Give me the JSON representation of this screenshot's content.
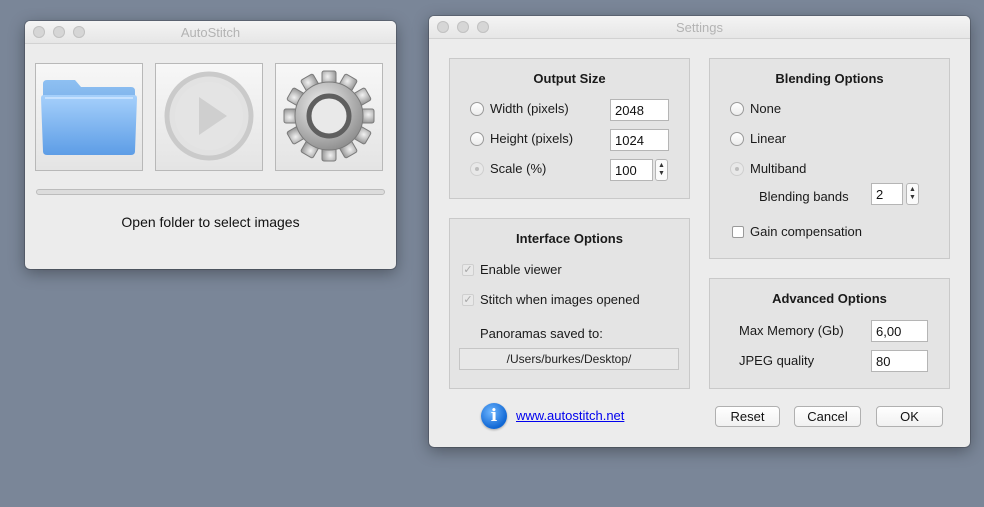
{
  "autostitch": {
    "title": "AutoStitch",
    "toolbar": [
      {
        "name": "open-folder-button",
        "icon": "folder-icon"
      },
      {
        "name": "stitch-play-button",
        "icon": "play-icon"
      },
      {
        "name": "settings-button",
        "icon": "gear-icon"
      }
    ],
    "progress": 0,
    "status": "Open folder to select images"
  },
  "settings": {
    "title": "Settings",
    "output_size": {
      "title": "Output Size",
      "width_label": "Width (pixels)",
      "width_value": "2048",
      "height_label": "Height (pixels)",
      "height_value": "1024",
      "scale_label": "Scale (%)",
      "scale_value": "100",
      "selected": "Scale (%)"
    },
    "interface_options": {
      "title": "Interface Options",
      "enable_viewer_label": "Enable viewer",
      "enable_viewer_checked": true,
      "stitch_label": "Stitch when images opened",
      "stitch_checked": true,
      "panoramas_label": "Panoramas saved to:",
      "path": "/Users/burkes/Desktop/"
    },
    "blending_options": {
      "title": "Blending Options",
      "none_label": "None",
      "linear_label": "Linear",
      "multiband_label": "Multiband",
      "selected": "Multiband",
      "bands_label": "Blending bands",
      "bands_value": "2",
      "gain_label": "Gain compensation",
      "gain_checked": false
    },
    "advanced_options": {
      "title": "Advanced Options",
      "memory_label": "Max Memory (Gb)",
      "memory_value": "6,00",
      "jpeg_label": "JPEG quality",
      "jpeg_value": "80"
    },
    "link": "www.autostitch.net",
    "buttons": {
      "reset": "Reset",
      "cancel": "Cancel",
      "ok": "OK"
    }
  }
}
